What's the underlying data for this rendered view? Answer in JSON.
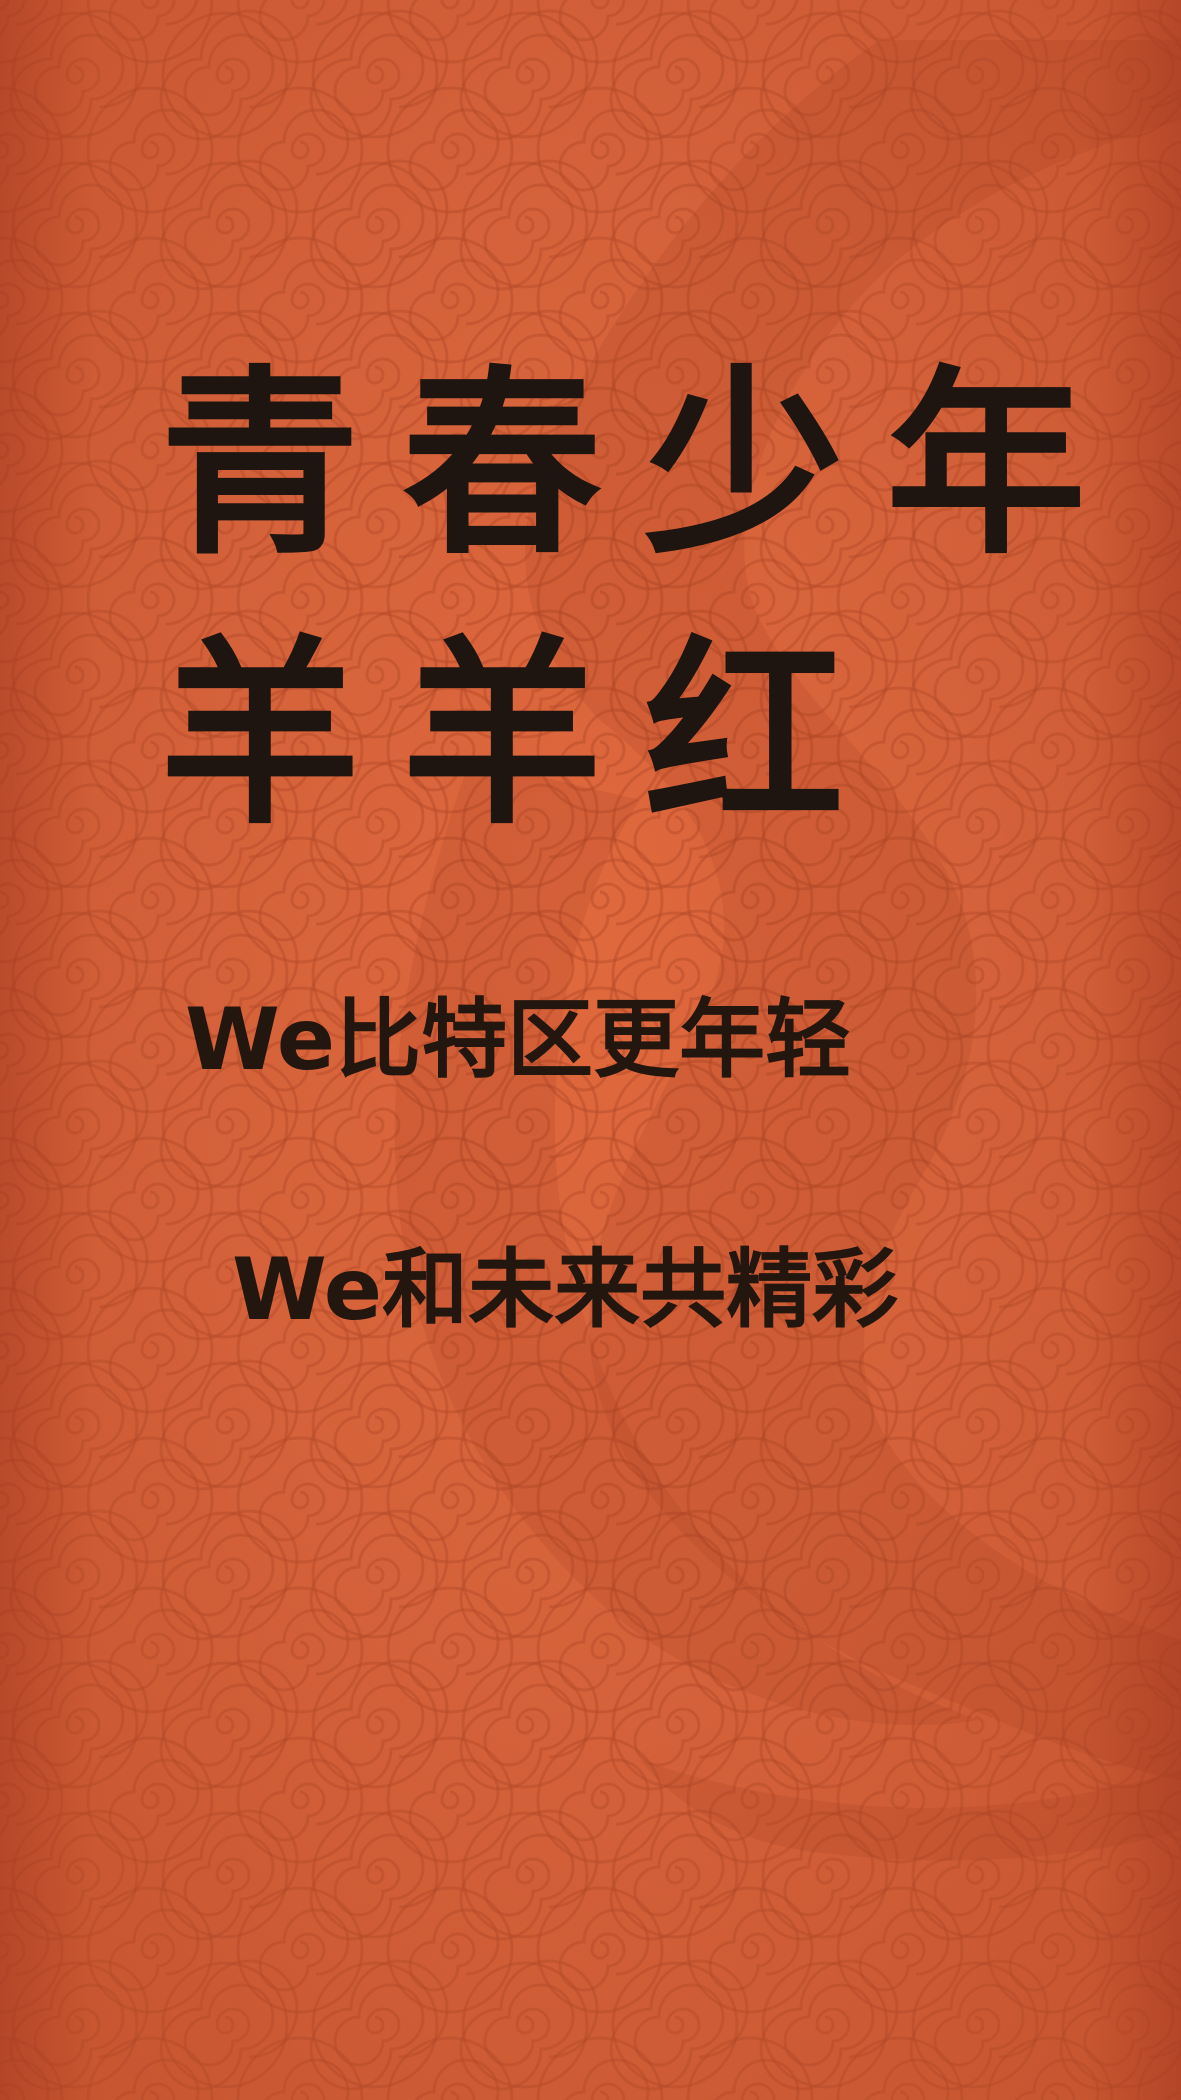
{
  "headline": {
    "line1": "青春少年",
    "line2": "羊羊红"
  },
  "slogans": [
    "We比特区更年轻",
    "We和未来共精彩"
  ],
  "colors": {
    "background": "#d5623a",
    "pattern": "#b84d2c",
    "text": "#1e1410"
  }
}
